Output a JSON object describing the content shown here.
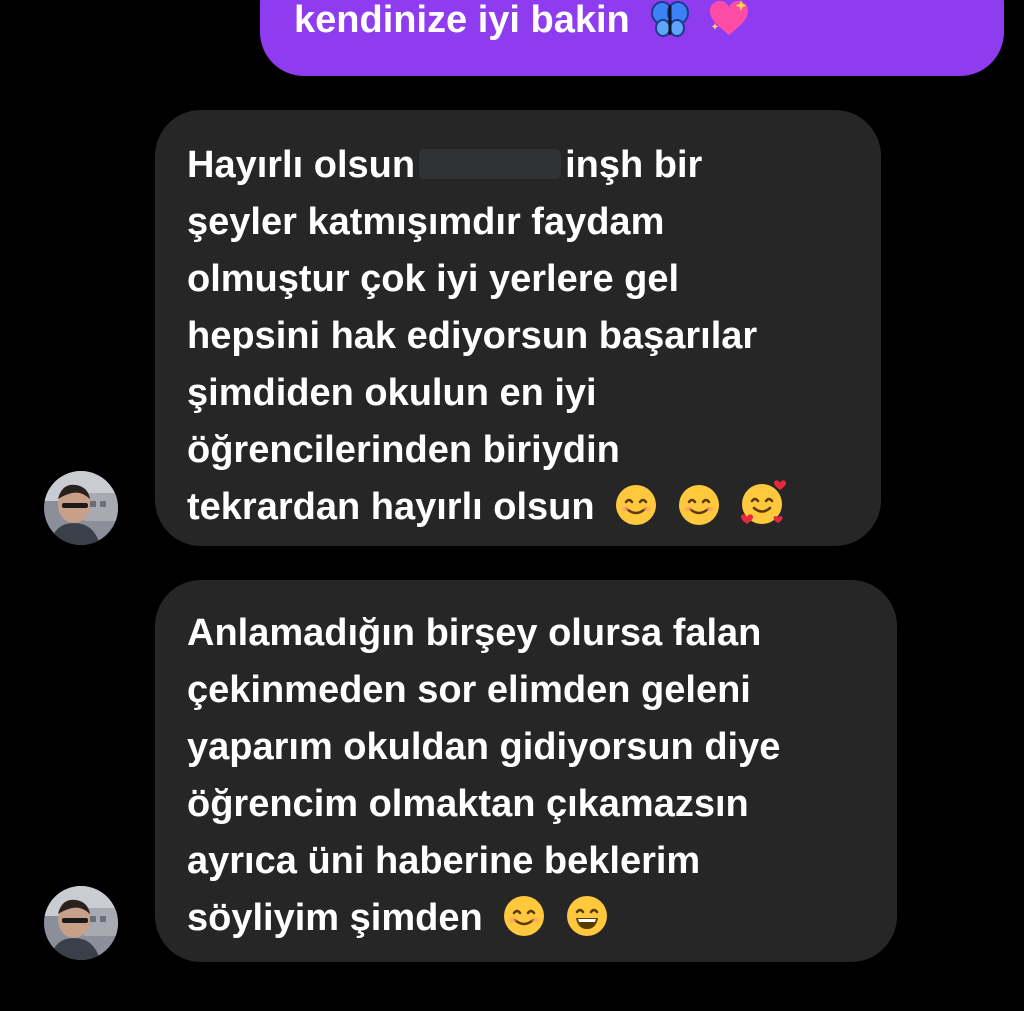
{
  "messages": {
    "outgoing": {
      "text": "kendinize iyi bakin",
      "emojis": [
        "butterfly-emoji",
        "sparkling-heart-emoji"
      ]
    },
    "incoming": [
      {
        "avatar": "sender-avatar-photo",
        "lines": [
          "Hayırlı olsun",
          "inşh bir",
          "şeyler katmışımdır faydam",
          "olmuştur çok iyi yerlere gel",
          "hepsini hak ediyorsun başarılar",
          "şimdiden okulun en iyi",
          "öğrencilerinden biriydin",
          "tekrardan hayırlı olsun"
        ],
        "redacted_name": true,
        "trailing_emojis": [
          "smiling-face-emoji",
          "smiling-face-emoji",
          "smiling-face-with-hearts-emoji"
        ]
      },
      {
        "avatar": "sender-avatar-photo",
        "lines": [
          "Anlamadığın birşey olursa falan",
          "çekinmeden sor elimden geleni",
          "yaparım okuldan gidiyorsun diye",
          "öğrencim olmaktan çıkamazsın",
          "ayrıca üni haberine beklerim",
          "söyliyim şimden"
        ],
        "trailing_emojis": [
          "smiling-face-emoji",
          "grinning-face-emoji"
        ]
      }
    ]
  },
  "colors": {
    "background": "#000000",
    "outgoing_bubble": "#8f3cf0",
    "incoming_bubble": "#262626",
    "text": "#ffffff"
  }
}
